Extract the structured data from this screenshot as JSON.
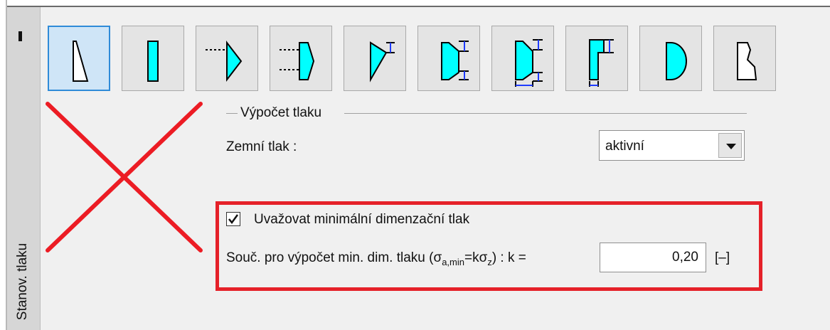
{
  "side_tab": {
    "label": "Stanov. tlaku"
  },
  "shape_buttons": [
    {
      "name": "sloping-wall",
      "selected": true
    },
    {
      "name": "rectangle-wall",
      "selected": false
    },
    {
      "name": "triangle-with-dashes",
      "selected": false
    },
    {
      "name": "trapezoid-with-dashes",
      "selected": false
    },
    {
      "name": "triangle-with-anchors",
      "selected": false
    },
    {
      "name": "trapezoid-with-anchors",
      "selected": false
    },
    {
      "name": "trapezoid-with-multiple-anchors",
      "selected": false
    },
    {
      "name": "stepped-wall-with-anchor",
      "selected": false
    },
    {
      "name": "semicircle",
      "selected": false
    },
    {
      "name": "custom-profile",
      "selected": false
    }
  ],
  "group": {
    "title": "Výpočet tlaku"
  },
  "earth_pressure": {
    "label": "Zemní tlak :",
    "value": "aktivní"
  },
  "min_pressure": {
    "checkbox_label": "Uvažovat minimální dimenzační tlak",
    "checked": true,
    "coef_label_prefix": "Souč. pro výpočet min. dim. tlaku (σ",
    "coef_sub1": "a,min",
    "coef_mid": "=kσ",
    "coef_sub2": "z",
    "coef_suffix": ") :  k =",
    "k_value": "0,20",
    "unit": "[–]"
  },
  "colors": {
    "accent": "#2f8bd8",
    "highlight": "#e52129",
    "cyan": "#00ffff",
    "cross": "#ec1c24"
  }
}
